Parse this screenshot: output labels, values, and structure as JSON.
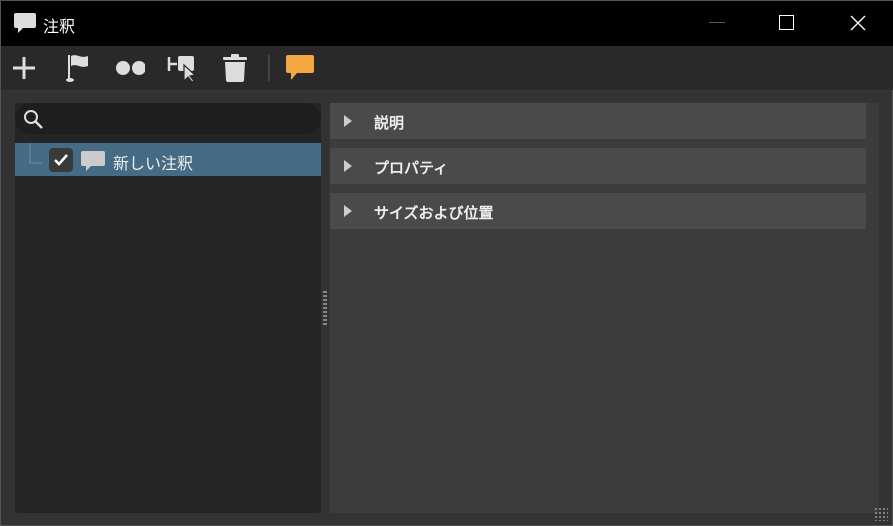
{
  "window": {
    "title": "注釈",
    "controls": [
      "minimize",
      "maximize",
      "close"
    ]
  },
  "toolbar": {
    "items": [
      "add-icon",
      "flag-icon",
      "glasses-icon",
      "select-tool-icon",
      "trash-icon",
      "annotation-comment-icon"
    ],
    "accent": "#f4a640"
  },
  "search": {
    "placeholder": "",
    "value": ""
  },
  "tree": {
    "items": [
      {
        "label": "新しい注釈",
        "checked": true
      }
    ]
  },
  "sections": [
    {
      "label": "説明"
    },
    {
      "label": "プロパティ"
    },
    {
      "label": "サイズおよび位置"
    }
  ]
}
